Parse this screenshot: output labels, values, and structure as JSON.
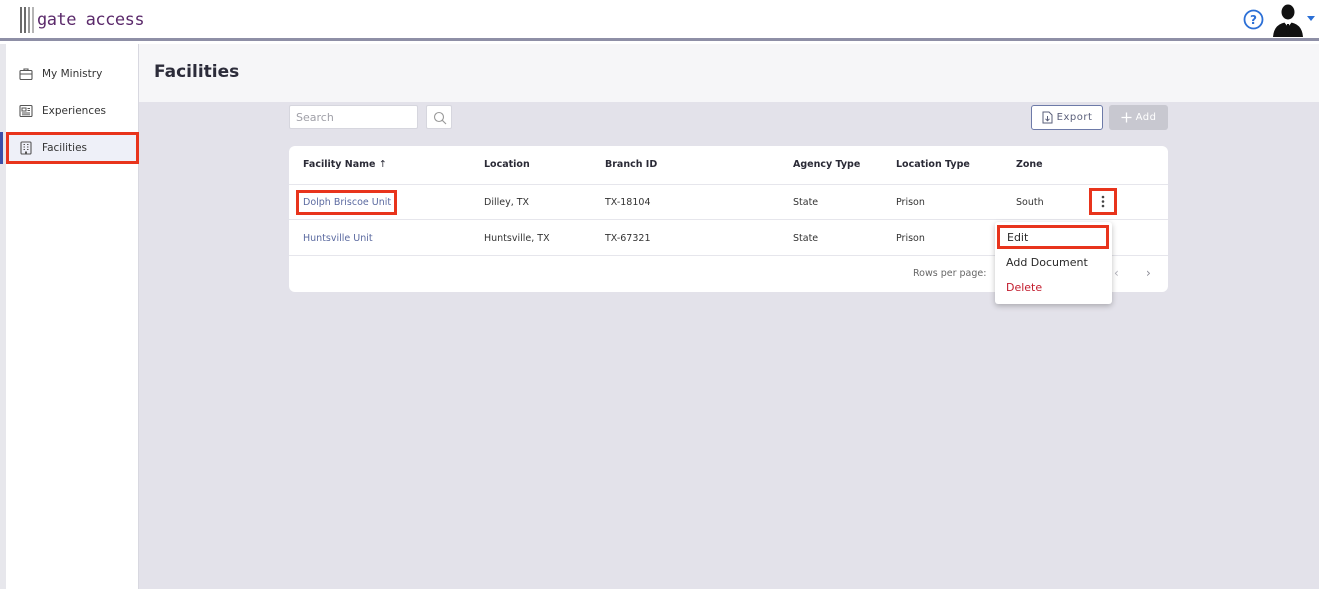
{
  "app": {
    "logo_text": "gate access"
  },
  "header": {
    "help_icon": "question-circle-icon",
    "avatar_icon": "user-avatar-icon"
  },
  "sidebar": {
    "items": [
      {
        "label": "My Ministry",
        "icon": "briefcase-icon"
      },
      {
        "label": "Experiences",
        "icon": "newspaper-icon"
      },
      {
        "label": "Facilities",
        "icon": "building-icon",
        "active": true
      }
    ]
  },
  "page": {
    "title": "Facilities"
  },
  "toolbar": {
    "search_placeholder": "Search",
    "export_label": "Export",
    "add_label": "Add"
  },
  "table": {
    "columns": [
      "Facility Name",
      "Location",
      "Branch ID",
      "Agency Type",
      "Location Type",
      "Zone"
    ],
    "sort_indicator": "↑",
    "rows": [
      {
        "name": "Dolph Briscoe Unit",
        "location": "Dilley, TX",
        "branch_id": "TX-18104",
        "agency_type": "State",
        "location_type": "Prison",
        "zone": "South"
      },
      {
        "name": "Huntsville Unit",
        "location": "Huntsville, TX",
        "branch_id": "TX-67321",
        "agency_type": "State",
        "location_type": "Prison",
        "zone": ""
      }
    ],
    "rows_per_page_label": "Rows per page:"
  },
  "row_menu": {
    "items": [
      "Edit",
      "Add Document",
      "Delete"
    ]
  },
  "colors": {
    "accent": "#3c4fa8",
    "highlight": "#e8341c",
    "link": "#5b6aa0",
    "danger": "#c21b2c",
    "logo": "#5b2a6b"
  }
}
